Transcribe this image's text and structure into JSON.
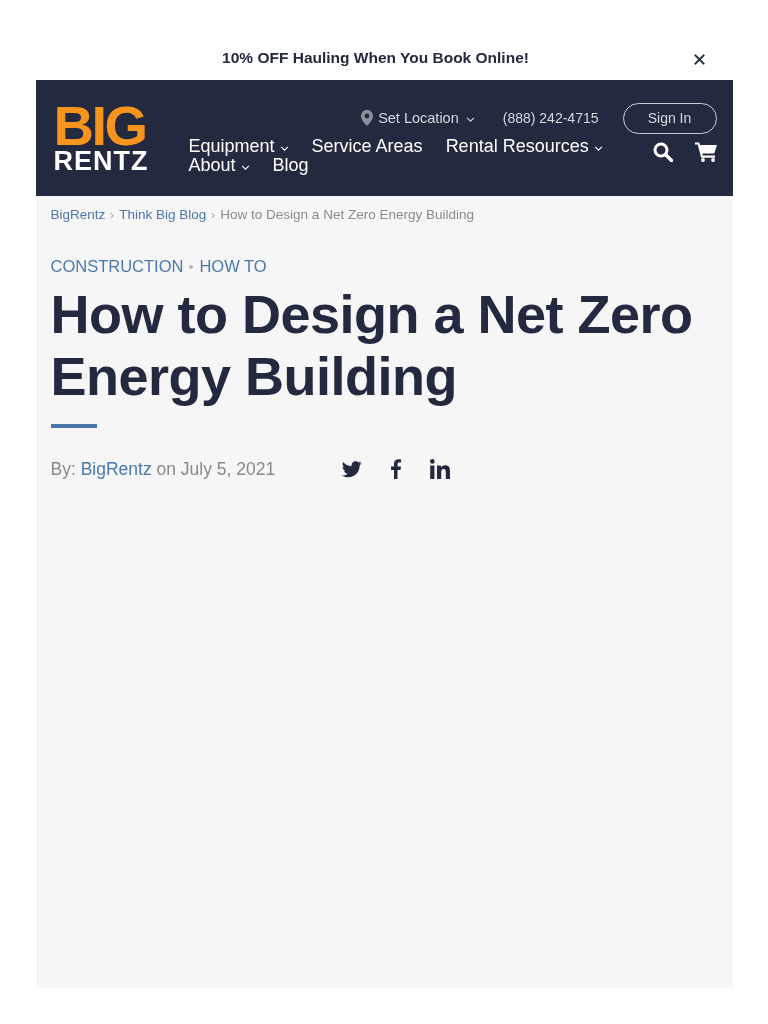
{
  "promo_bar": {
    "text": "10% OFF Hauling When You Book Online!"
  },
  "header": {
    "logo": {
      "line_1": "BIG",
      "line_2": "RENTZ"
    },
    "location": {
      "label": "Set Location",
      "has_menu": true
    },
    "phone": "(888) 242-4715",
    "sign_in": "Sign In",
    "nav": [
      {
        "label": "Equipment",
        "has_menu": true
      },
      {
        "label": "Service Areas",
        "has_menu": false
      },
      {
        "label": "Rental Resources",
        "has_menu": true
      },
      {
        "label": "About",
        "has_menu": true
      },
      {
        "label": "Blog",
        "has_menu": false
      }
    ]
  },
  "breadcrumb": [
    {
      "label": "BigRentz",
      "kind": "link"
    },
    {
      "label": "Think Big Blog",
      "kind": "link"
    },
    {
      "label": "How to Design a Net Zero Energy Building",
      "kind": "current"
    }
  ],
  "article": {
    "categories": [
      "CONSTRUCTION",
      "HOW TO"
    ],
    "title": "How to Design a Net Zero Energy Building",
    "byline": {
      "prefix": "By:",
      "author": "BigRentz",
      "suffix": "on July 5, 2021"
    }
  }
}
